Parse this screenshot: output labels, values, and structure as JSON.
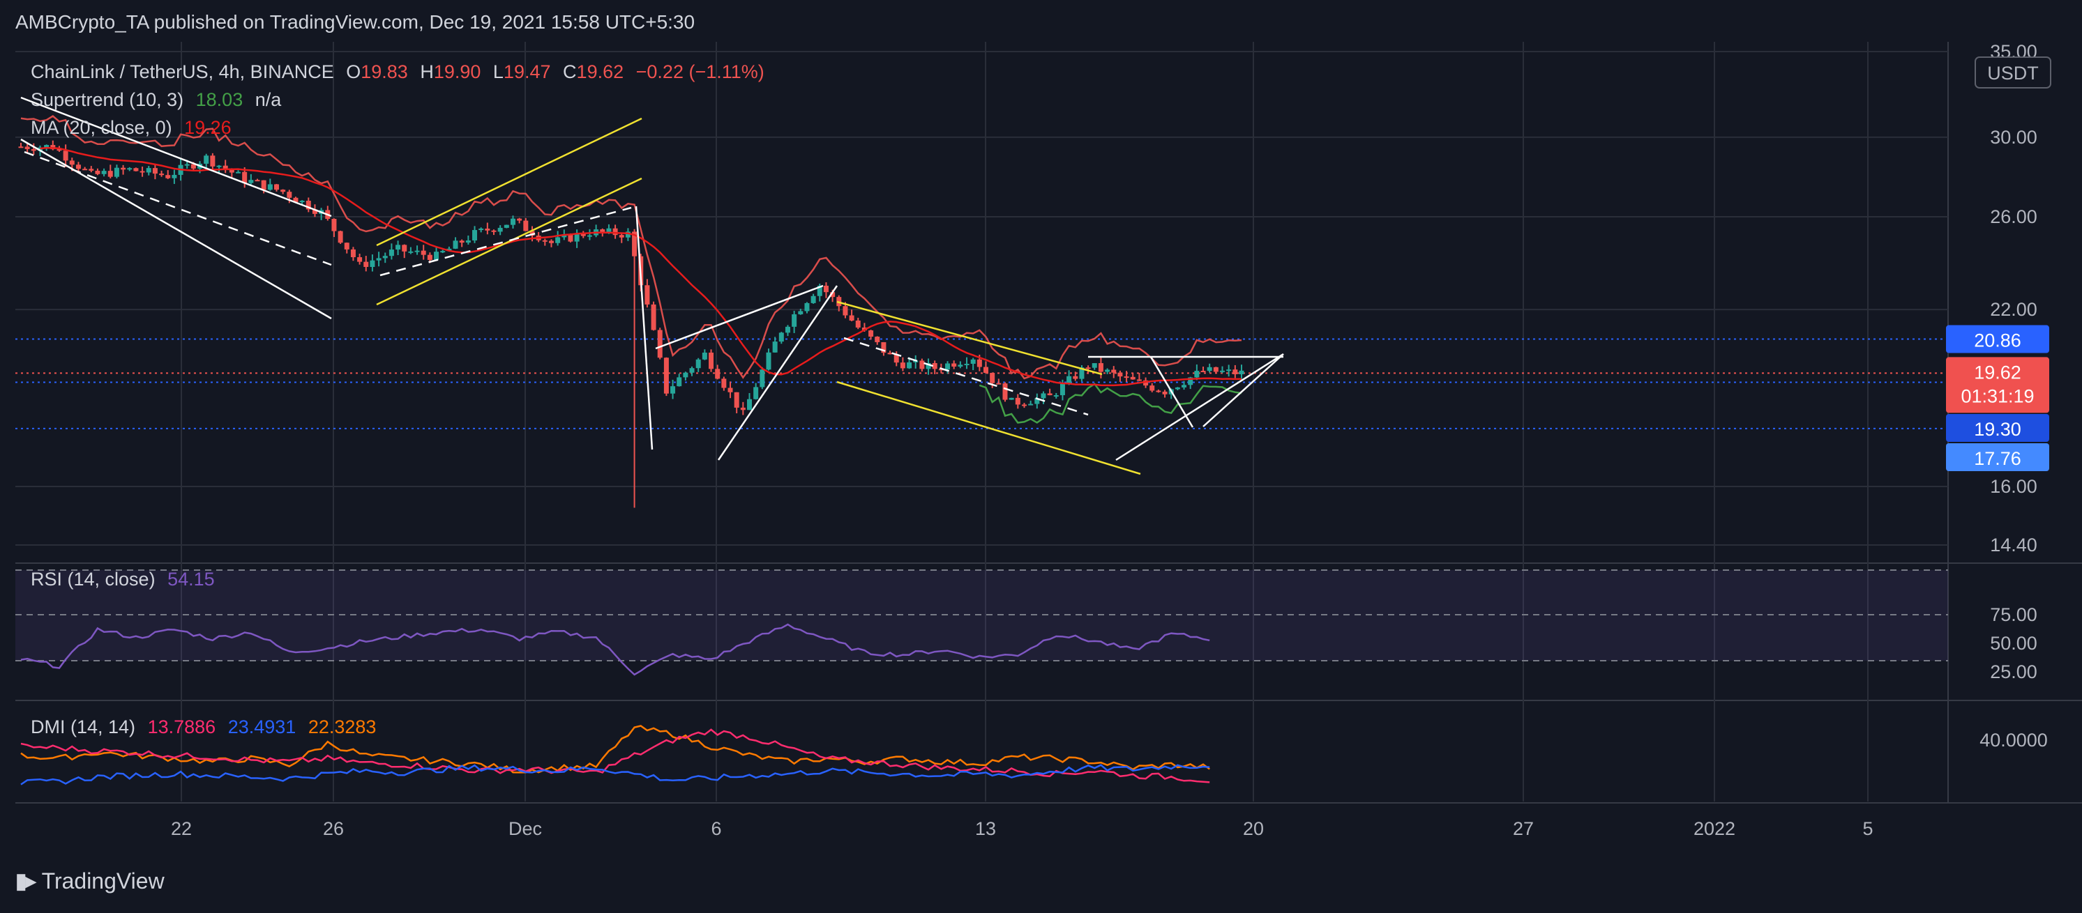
{
  "header": {
    "publisher_line": "AMBCrypto_TA published on TradingView.com, Dec 19, 2021 15:58 UTC+5:30"
  },
  "legend": {
    "symbol": "ChainLink / TetherUS, 4h, BINANCE",
    "o_label": "O",
    "o_value": "19.83",
    "h_label": "H",
    "h_value": "19.90",
    "l_label": "L",
    "l_value": "19.47",
    "c_label": "C",
    "c_value": "19.62",
    "change": "−0.22 (−1.11%)",
    "supertrend_label": "Supertrend (10, 3)",
    "supertrend_value": "18.03",
    "supertrend_extra": "n/a",
    "ma_label": "MA (20, close, 0)",
    "ma_value": "19.26",
    "rsi_label": "RSI (14, close)",
    "rsi_value": "54.15",
    "dmi_label": "DMI (14, 14)",
    "dmi_v1": "13.7886",
    "dmi_v2": "23.4931",
    "dmi_v3": "22.3283"
  },
  "currency_badge": "USDT",
  "price_tags": {
    "resistance": "20.86",
    "last_price": "19.62",
    "countdown": "01:31:19",
    "support_1": "19.30",
    "support_2": "17.76"
  },
  "footer": {
    "brand": "TradingView"
  },
  "colors": {
    "background": "#131722",
    "bull": "#26a69a",
    "bear": "#ef5350",
    "ma": "#e81c1c",
    "supertrend_up": "#43a047",
    "rsi": "#7e57c2",
    "dmi_plus": "#ff2d6f",
    "dmi_minus": "#2962ff",
    "adx": "#ff7a00",
    "level_line": "#2962ff",
    "channel_yellow": "#f0e130"
  },
  "chart_data": [
    {
      "type": "candlestick",
      "pane": "price",
      "title": "ChainLink / TetherUS, 4h, BINANCE",
      "ylabel": "USDT",
      "y_ticks": [
        "35.00",
        "30.00",
        "26.00",
        "22.00",
        "16.00",
        "14.40"
      ],
      "ylim": [
        14.4,
        35.0
      ],
      "log_scale": true,
      "x_ticks": [
        "22",
        "26",
        "Dec",
        "6",
        "13",
        "20",
        "27",
        "2022",
        "5"
      ],
      "grid": true,
      "x": [
        "Nov 18",
        "Nov 19",
        "Nov 20",
        "Nov 21",
        "Nov 22",
        "Nov 23",
        "Nov 24",
        "Nov 25",
        "Nov 26",
        "Nov 27",
        "Nov 28",
        "Nov 29",
        "Nov 30",
        "Dec 1",
        "Dec 2",
        "Dec 3",
        "Dec 4",
        "Dec 5",
        "Dec 6",
        "Dec 7",
        "Dec 8",
        "Dec 9",
        "Dec 10",
        "Dec 11",
        "Dec 12",
        "Dec 13",
        "Dec 14",
        "Dec 15",
        "Dec 16",
        "Dec 17",
        "Dec 18",
        "Dec 19"
      ],
      "close": [
        29.5,
        28.0,
        28.3,
        28.0,
        28.9,
        27.8,
        27.2,
        26.2,
        23.8,
        24.5,
        24.2,
        25.2,
        25.8,
        24.8,
        25.3,
        25.2,
        19.0,
        20.3,
        18.2,
        21.2,
        23.0,
        21.3,
        20.0,
        19.8,
        20.2,
        18.6,
        18.8,
        19.9,
        19.4,
        19.0,
        19.7,
        19.62
      ],
      "levels": [
        {
          "name": "resistance",
          "value": 20.86
        },
        {
          "name": "support",
          "value": 19.3
        },
        {
          "name": "support",
          "value": 17.76
        }
      ],
      "last_price": 19.62,
      "indicators": {
        "supertrend": {
          "period": 10,
          "factor": 3,
          "value": 18.03
        },
        "ma": {
          "period": 20,
          "value": 19.26
        }
      }
    },
    {
      "type": "line",
      "pane": "rsi",
      "title": "RSI (14, close)",
      "y_ticks": [
        "75.00",
        "50.00",
        "25.00"
      ],
      "ylim": [
        20,
        76
      ],
      "bands": [
        70,
        50,
        30
      ],
      "series": [
        {
          "name": "RSI (14, close)",
          "values": [
            36,
            30,
            62,
            55,
            62,
            54,
            60,
            42,
            46,
            52,
            56,
            60,
            62,
            54,
            60,
            55,
            24,
            40,
            36,
            52,
            66,
            54,
            42,
            40,
            44,
            38,
            40,
            58,
            52,
            44,
            58,
            54.15
          ]
        }
      ]
    },
    {
      "type": "line",
      "pane": "dmi",
      "title": "DMI (14, 14)",
      "y_ticks": [
        "40.0000"
      ],
      "series": [
        {
          "name": "13.7886",
          "values": [
            36,
            35,
            33,
            32,
            30,
            29,
            27,
            26,
            28,
            25,
            24,
            22,
            20,
            21,
            20,
            19,
            30,
            40,
            46,
            42,
            35,
            28,
            26,
            24,
            22,
            21,
            20,
            18,
            20,
            17,
            16,
            13.79
          ]
        },
        {
          "name": "23.4931",
          "values": [
            12,
            13,
            16,
            17,
            18,
            17,
            16,
            15,
            18,
            20,
            19,
            21,
            22,
            21,
            20,
            22,
            18,
            14,
            15,
            17,
            18,
            20,
            19,
            18,
            17,
            18,
            17,
            20,
            22,
            21,
            23,
            23.49
          ]
        },
        {
          "name": "22.3283",
          "values": [
            30,
            28,
            32,
            30,
            28,
            26,
            28,
            24,
            38,
            30,
            28,
            26,
            24,
            20,
            22,
            23,
            48,
            44,
            36,
            30,
            26,
            28,
            26,
            28,
            26,
            25,
            29,
            28,
            26,
            22,
            24,
            22.33
          ]
        }
      ]
    }
  ]
}
